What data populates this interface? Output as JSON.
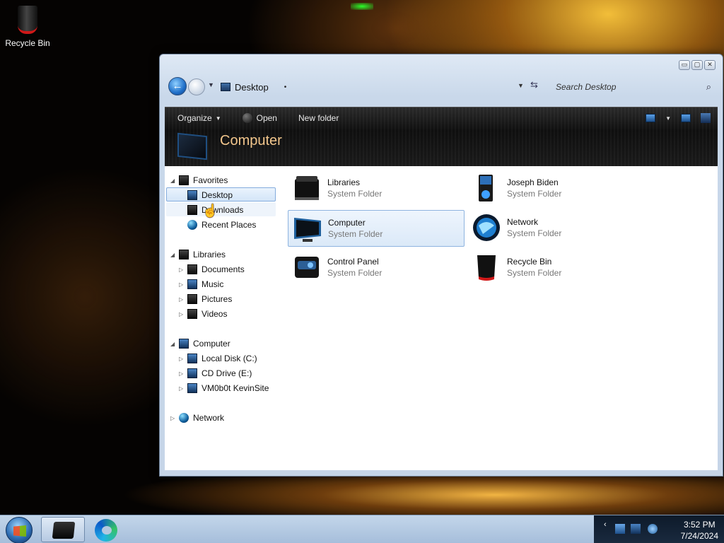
{
  "desktop": {
    "icons": [
      {
        "label": "Recycle Bin",
        "icon": "recycle-bin-icon"
      }
    ]
  },
  "window": {
    "address": {
      "path": "Desktop"
    },
    "search": {
      "placeholder": "Search Desktop"
    },
    "caption_buttons": {
      "minimize": "▭",
      "maximize": "▢",
      "close": "✕"
    },
    "commands": {
      "organize": "Organize",
      "open": "Open",
      "new_folder": "New folder"
    },
    "header": {
      "title": "Computer"
    },
    "nav": {
      "favorites": "Favorites",
      "desktop": "Desktop",
      "downloads": "Downloads",
      "recent_places": "Recent Places",
      "libraries": "Libraries",
      "documents": "Documents",
      "music": "Music",
      "pictures": "Pictures",
      "videos": "Videos",
      "computer": "Computer",
      "local_disk": "Local Disk (C:)",
      "cd_drive": "CD Drive (E:)",
      "vm_share": "VM0b0t KevinSite",
      "network": "Network"
    },
    "items": [
      {
        "name": "Libraries",
        "type": "System Folder",
        "icon": "libraries-icon"
      },
      {
        "name": "Joseph Biden",
        "type": "System Folder",
        "icon": "user-folder-icon"
      },
      {
        "name": "Computer",
        "type": "System Folder",
        "icon": "computer-icon"
      },
      {
        "name": "Network",
        "type": "System Folder",
        "icon": "network-icon"
      },
      {
        "name": "Control Panel",
        "type": "System Folder",
        "icon": "control-panel-icon"
      },
      {
        "name": "Recycle Bin",
        "type": "System Folder",
        "icon": "recycle-bin-icon"
      }
    ]
  },
  "taskbar": {
    "clock": {
      "time": "3:52 PM",
      "date": "7/24/2024"
    },
    "tray_chevron": "‹"
  },
  "colors": {
    "accent": "#1f6fc9",
    "header_title": "#f2c68c",
    "taskbar": "#b5c9e2"
  }
}
